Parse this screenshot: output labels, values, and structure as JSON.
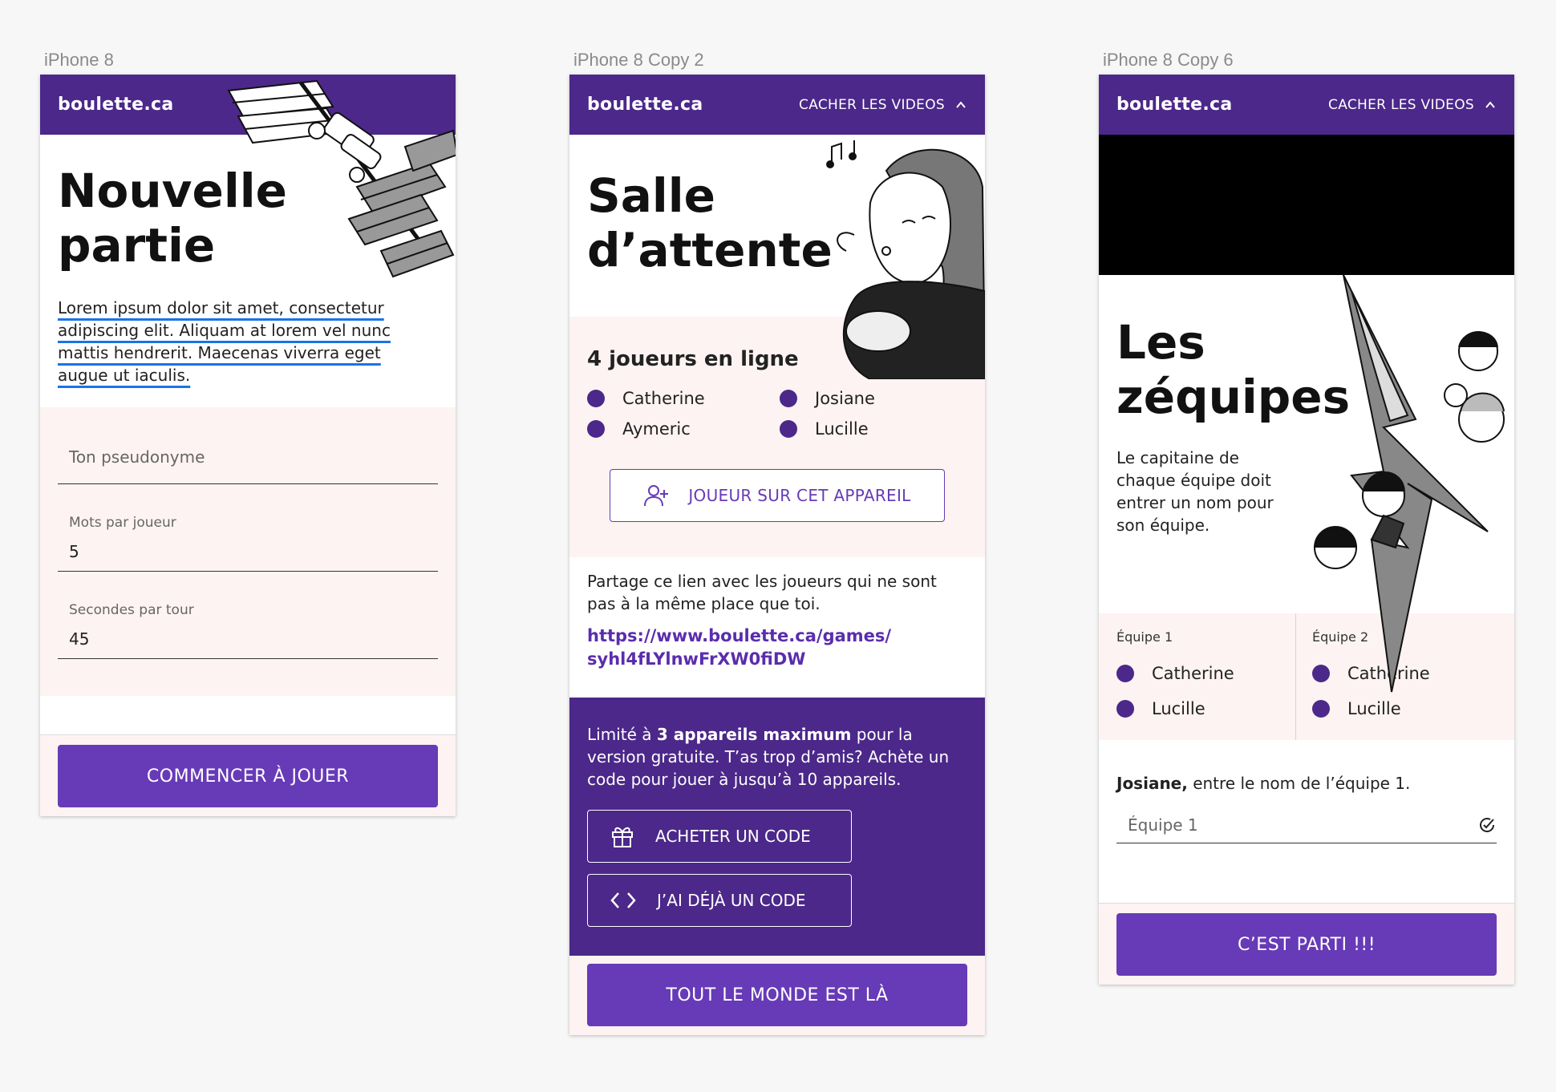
{
  "frames": {
    "f1": {
      "label": "iPhone 8"
    },
    "f2": {
      "label": "iPhone 8 Copy 2"
    },
    "f3": {
      "label": "iPhone 8 Copy 6"
    }
  },
  "app": {
    "brand": "boulette.ca",
    "hide_videos": "CACHER LES VIDEOS"
  },
  "new_game": {
    "title_line1": "Nouvelle",
    "title_line2": "partie",
    "lorem": "Lorem ipsum dolor sit amet, consectetur adipiscing elit. Aliquam at lorem vel nunc mattis hendrerit. Maecenas viverra eget augue ut iaculis.",
    "nickname_placeholder": "Ton pseudonyme",
    "words_label": "Mots par joueur",
    "words_value": "5",
    "seconds_label": "Secondes par tour",
    "seconds_value": "45",
    "start_button": "COMMENCER À JOUER"
  },
  "waiting_room": {
    "title_line1": "Salle",
    "title_line2": "d’attente",
    "online_count": "4 joueurs en ligne",
    "players": [
      "Catherine",
      "Josiane",
      "Aymeric",
      "Lucille"
    ],
    "add_player_button": "JOUEUR SUR CET APPAREIL",
    "share_text": "Partage ce lien avec les joueurs qui ne sont pas à la même place que toi.",
    "share_link_line1": "https://www.boulette.ca/games/",
    "share_link_line2": "syhl4fLYlnwFrXW0fiDW",
    "limit_prefix": "Limité à ",
    "limit_bold": "3 appareils maximum",
    "limit_suffix": " pour la version gratuite. T’as trop d’amis? Achète un code pour jouer à jusqu’à 10 appareils.",
    "buy_code_button": "ACHETER UN CODE",
    "have_code_button": "J’AI DÉJÀ UN CODE",
    "everyone_here_button": "TOUT LE MONDE EST LÀ"
  },
  "teams": {
    "title_line1": "Les",
    "title_line2": "zéquipes",
    "description": "Le capitaine de chaque équipe doit entrer un nom pour son équipe.",
    "team1_label": "Équipe 1",
    "team1_players": [
      "Catherine",
      "Lucille"
    ],
    "team2_label": "Équipe 2",
    "team2_players": [
      "Catherine",
      "Lucille"
    ],
    "prompt_name": "Josiane,",
    "prompt_text": " entre le nom de l’équipe 1.",
    "team_name_placeholder": "Équipe 1",
    "go_button": "C’EST PARTI !!!"
  },
  "colors": {
    "appbar": "#4b2889",
    "primary": "#673ab7",
    "pink_section": "#fdf3f2",
    "link": "#5a2dad"
  },
  "icons": [
    "chevron-up-icon",
    "add-person-icon",
    "gift-icon",
    "code-icon",
    "check-circle-icon"
  ]
}
